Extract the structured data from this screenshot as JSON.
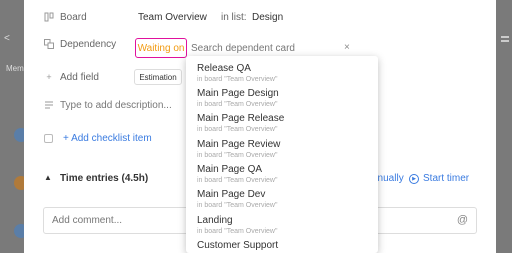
{
  "background": {
    "left_arrow": "<",
    "left_label": "Mem"
  },
  "card": {
    "board_label": "Board",
    "board_value": "Team Overview",
    "in_list_label": "in list:",
    "list_value": "Design",
    "dependency_label": "Dependency",
    "dependency_type": "Waiting on",
    "dependency_search_placeholder": "Search dependent card",
    "add_field_label": "Add field",
    "estimation_tag": "Estimation",
    "description_placeholder": "Type to add description...",
    "add_checklist_label": "+ Add checklist item",
    "time_entries_label": "Time entries (4.5h)",
    "manually_label": "anually",
    "start_timer_label": "Start timer",
    "comment_placeholder": "Add comment...",
    "comment_icon": "@"
  },
  "dropdown": {
    "items": [
      {
        "title": "Release QA",
        "subtitle": "in board \"Team Overview\""
      },
      {
        "title": "Main Page Design",
        "subtitle": "in board \"Team Overview\""
      },
      {
        "title": "Main Page Release",
        "subtitle": "in board \"Team Overview\""
      },
      {
        "title": "Main Page Review",
        "subtitle": "in board \"Team Overview\""
      },
      {
        "title": "Main Page QA",
        "subtitle": "in board \"Team Overview\""
      },
      {
        "title": "Main Page Dev",
        "subtitle": "in board \"Team Overview\""
      },
      {
        "title": "Landing",
        "subtitle": "in board \"Team Overview\""
      },
      {
        "title": "Customer Support",
        "subtitle": ""
      }
    ]
  },
  "colors": {
    "accent_blue": "#3a7be0",
    "pill_border": "#e0119d",
    "pill_text": "#f29b12"
  },
  "icons": {
    "board": "board-icon",
    "dependency": "dependency-icon",
    "add_field": "plus-icon",
    "description": "lines-icon",
    "checkbox": "checkbox-icon",
    "close": "close-icon",
    "chevron": "chevron-up-icon",
    "play": "play-circle-icon",
    "mention": "at-icon"
  }
}
